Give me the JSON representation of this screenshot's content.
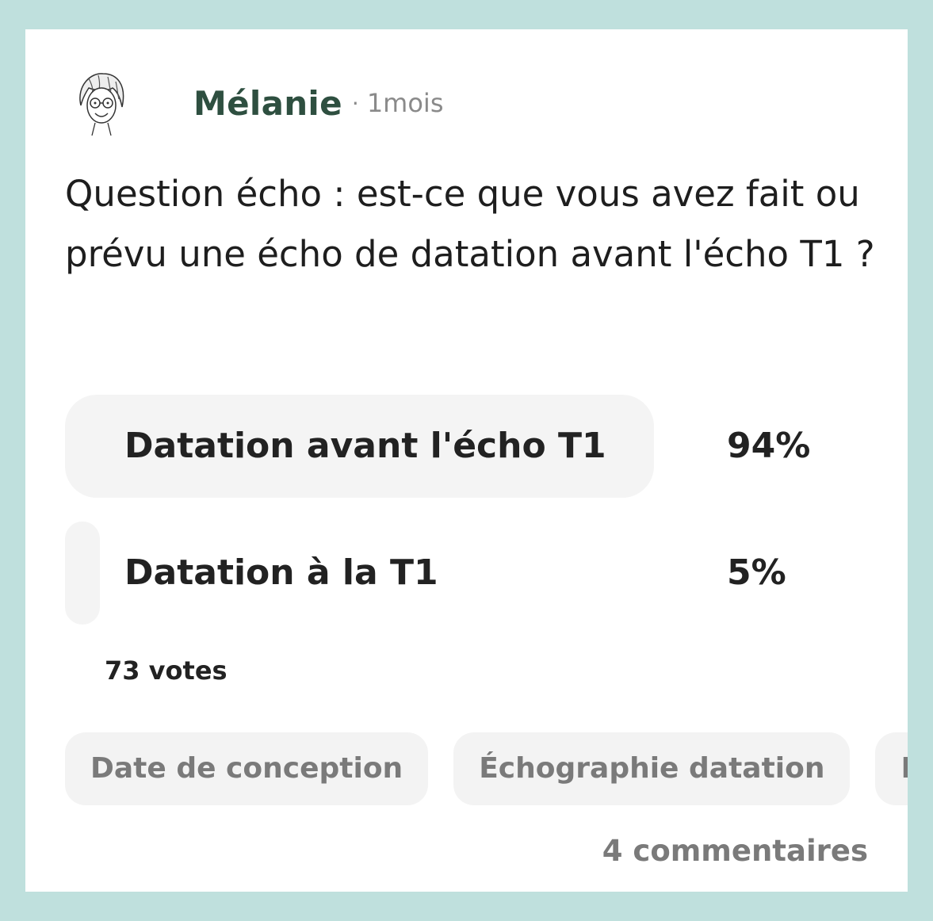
{
  "post": {
    "author": "Mélanie",
    "separator": "·",
    "time": "1mois",
    "question": "Question écho : est-ce que vous avez fait ou prévu une écho de datation avant l'écho T1 ?"
  },
  "poll": {
    "options": [
      {
        "label": "Datation avant l'écho T1",
        "percent_text": "94%",
        "percent": 94
      },
      {
        "label": "Datation à la T1",
        "percent_text": "5%",
        "percent": 5
      }
    ],
    "votes": "73 votes"
  },
  "tags": [
    "Date de conception",
    "Échographie datation",
    "Date"
  ],
  "footer": {
    "comments": "4 commentaires"
  },
  "colors": {
    "background": "#bfe0dd",
    "author": "#2e4f40",
    "bar": "#f4f4f4"
  }
}
